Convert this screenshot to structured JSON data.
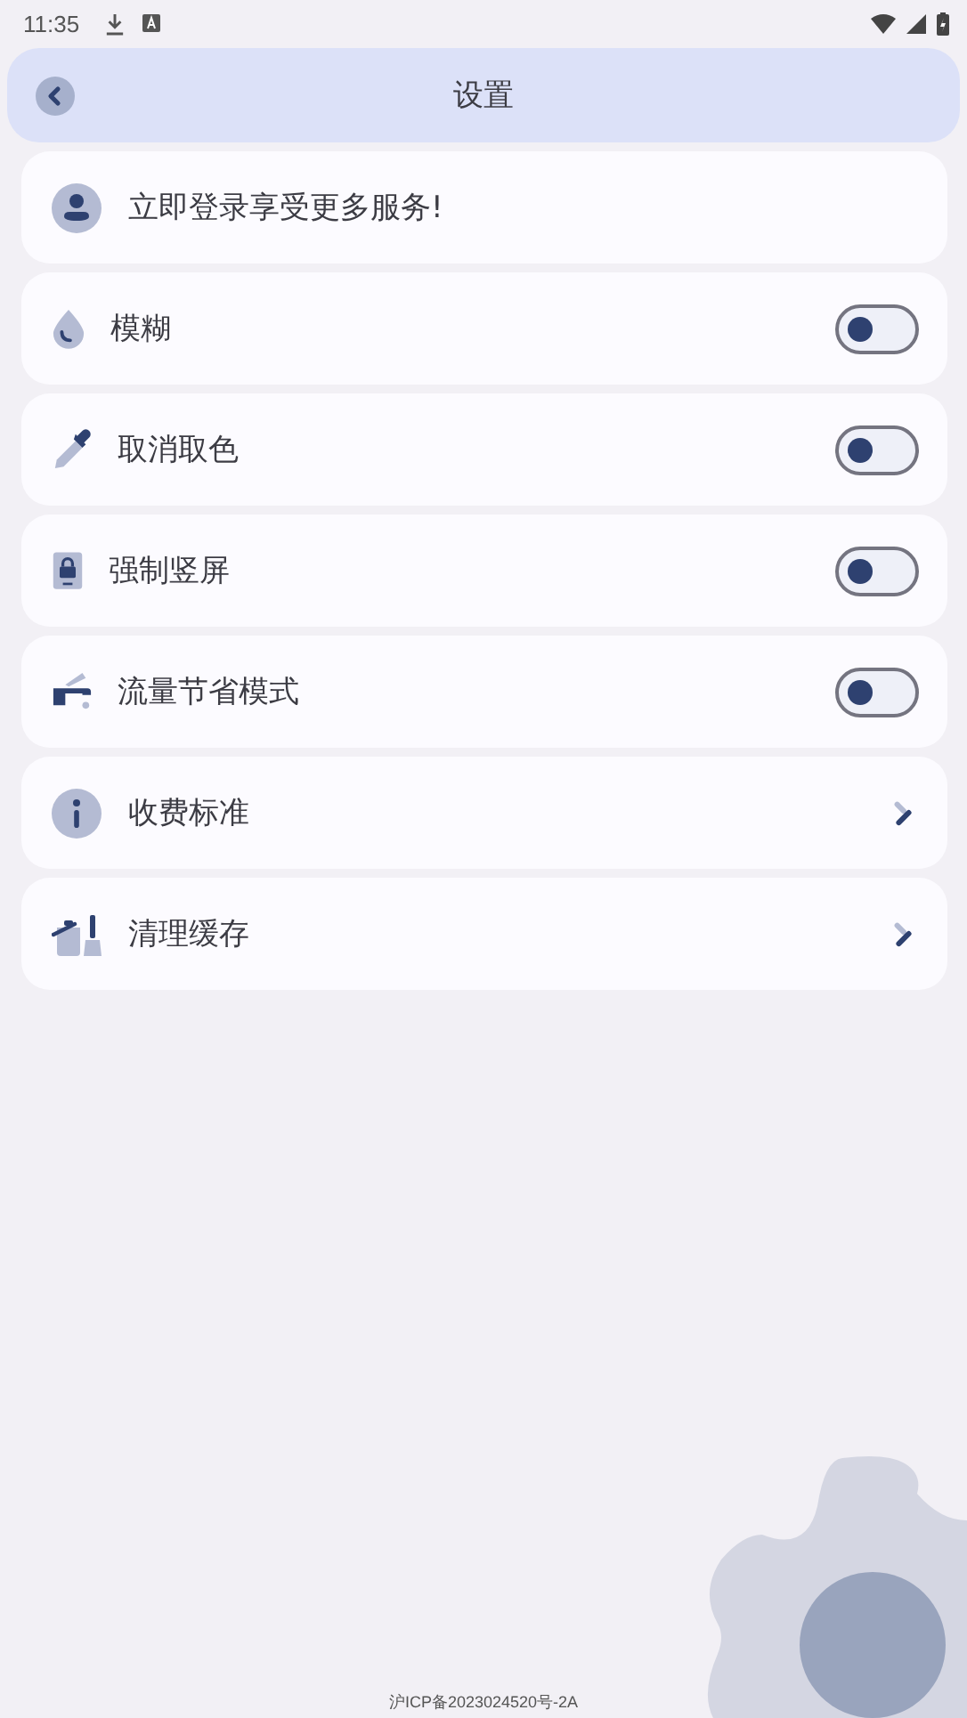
{
  "status_bar": {
    "time": "11:35"
  },
  "header": {
    "title": "设置"
  },
  "items": [
    {
      "kind": "login",
      "label": "立即登录享受更多服务!"
    },
    {
      "kind": "toggle",
      "label": "模糊",
      "on": false
    },
    {
      "kind": "toggle",
      "label": "取消取色",
      "on": false
    },
    {
      "kind": "toggle",
      "label": "强制竖屏",
      "on": false
    },
    {
      "kind": "toggle",
      "label": "流量节省模式",
      "on": false
    },
    {
      "kind": "link",
      "label": "收费标准"
    },
    {
      "kind": "link",
      "label": "清理缓存"
    }
  ],
  "footer": {
    "text": "沪ICP备2023024520号-2A"
  }
}
